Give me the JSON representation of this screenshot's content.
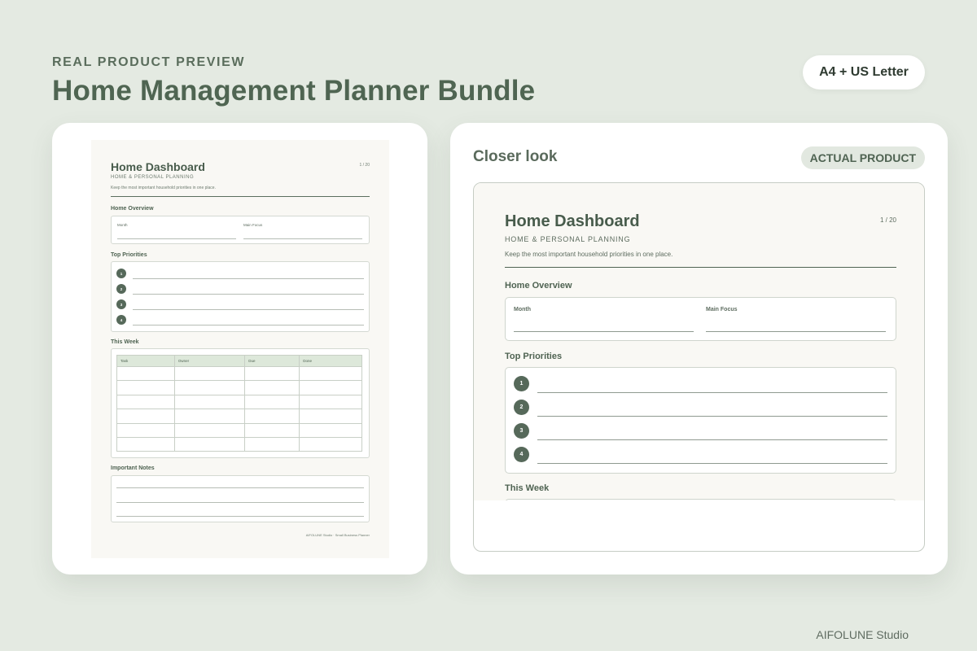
{
  "header": {
    "eyebrow": "REAL PRODUCT PREVIEW",
    "title": "Home Management Planner Bundle",
    "format_pill": "A4 + US Letter"
  },
  "planner_page": {
    "title": "Home Dashboard",
    "subtitle": "HOME & PERSONAL PLANNING",
    "description": "Keep the most important household priorities in one place.",
    "page_number": "1 / 20",
    "sections": {
      "overview": "Home Overview",
      "priorities": "Top Priorities",
      "week": "This Week",
      "notes": "Important Notes"
    },
    "overview_fields": [
      "Month",
      "Main Focus"
    ],
    "priority_numbers": [
      "1",
      "2",
      "3",
      "4"
    ],
    "week_columns": [
      "Task",
      "Owner",
      "Due",
      "Done"
    ],
    "footer": "AIFOLUNE Studio · Small Business Planner"
  },
  "closer_look": {
    "heading": "Closer look",
    "badge": "ACTUAL PRODUCT"
  },
  "brand": "AIFOLUNE Studio",
  "colors": {
    "background": "#e4eae2",
    "accent": "#56695a",
    "page": "#f9f8f4",
    "table_header": "#dde8da"
  }
}
